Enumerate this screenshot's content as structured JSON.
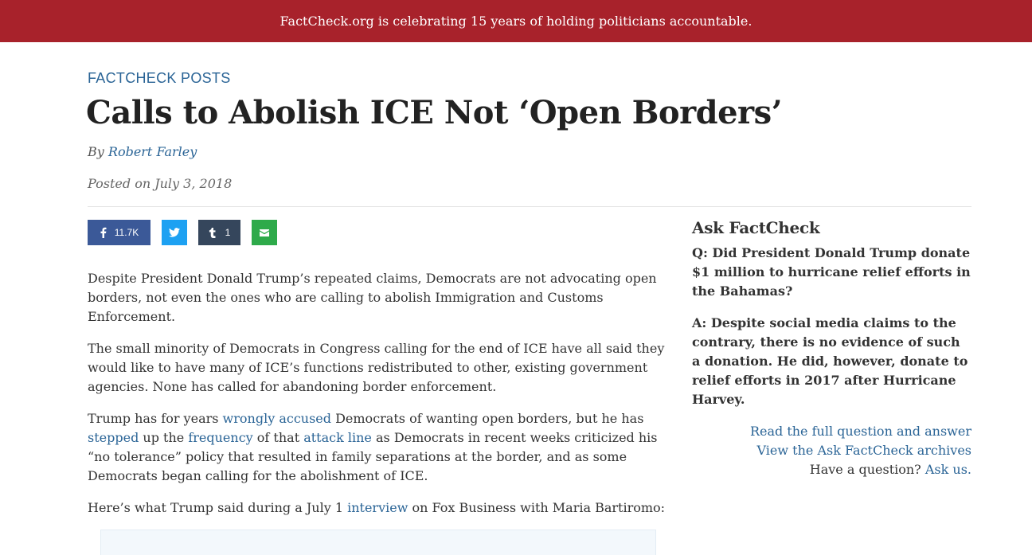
{
  "banner": {
    "text": "FactCheck.org is celebrating 15 years of holding politicians accountable."
  },
  "post": {
    "category": "FACTCHECK POSTS",
    "title": "Calls to Abolish ICE Not ‘Open Borders’",
    "byline_prefix": "By ",
    "author": "Robert Farley",
    "posted": "Posted on July 3, 2018"
  },
  "share": {
    "facebook_count": "11.7K",
    "tumblr_count": "1",
    "icons": [
      "facebook-icon",
      "twitter-icon",
      "tumblr-icon",
      "email-icon"
    ]
  },
  "article": {
    "p1": "Despite President Donald Trump’s repeated claims, Democrats are not advocating open borders, not even the ones who are calling to abolish Immigration and Customs Enforcement.",
    "p2": "The small minority of Democrats in Congress calling for the end of ICE have all said they would like to have many of ICE’s functions redistributed to other, existing government agencies. None has called for abandoning border enforcement.",
    "p3": {
      "t1": "Trump has for years ",
      "l1": "wrongly accused",
      "t2": " Democrats of wanting open borders, but he has ",
      "l2": "stepped",
      "t3": " up the ",
      "l3": "frequency",
      "t4": " of that ",
      "l4": "attack line",
      "t5": " as Democrats in recent weeks criticized his “no tolerance” policy that resulted in family separations at the border, and as some Democrats began calling for the abolishment of ICE."
    },
    "p4": {
      "t1": "Here’s what Trump said during a July 1 ",
      "l1": "interview",
      "t2": " on Fox Business with Maria Bartiromo:"
    }
  },
  "sidebar": {
    "heading": "Ask FactCheck",
    "question": "Q: Did President Donald Trump donate $1 million to hurricane relief efforts in the Bahamas?",
    "answer": "A: Despite social media claims to the contrary, there is no evidence of such a donation. He did, however, donate to relief efforts in 2017 after Hurricane Harvey.",
    "link_full": "Read the full question and answer",
    "link_archives": "View the Ask FactCheck archives",
    "have_question": "Have a question? ",
    "ask_us": "Ask us."
  },
  "colors": {
    "banner": "#a8222b",
    "link": "#2a6496",
    "facebook": "#3b5998",
    "twitter": "#1da1f2",
    "tumblr": "#35465c",
    "email": "#2eaa4a"
  }
}
